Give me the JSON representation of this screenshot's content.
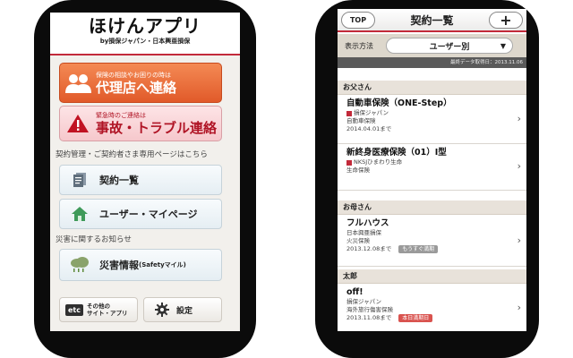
{
  "left": {
    "logo_title": "ほけんアプリ",
    "logo_sub": "by損保ジャパン・日本興亜損保",
    "agent_button": {
      "small": "保険の相談やお困りの時は",
      "big": "代理店へ連絡"
    },
    "emergency_button": {
      "small": "緊急時のご連絡は",
      "big": "事故・トラブル連絡"
    },
    "contract_section": "契約管理・ご契約者さま専用ページはこちら",
    "contract_list": "契約一覧",
    "mypage": "ユーザー・マイページ",
    "disaster_section": "災害に関するお知らせ",
    "disaster_info": "災害情報",
    "safety": "(Safetyマイル)",
    "etc": "etc",
    "other_sites_line1": "その他の",
    "other_sites_line2": "サイト・アプリ",
    "settings": "設定"
  },
  "right": {
    "top_button": "TOP",
    "title": "契約一覧",
    "plus": "+",
    "display_label": "表示方法",
    "display_value": "ユーザー別",
    "update_date": "最終データ取得日：2013.11.06",
    "groups": [
      {
        "name": "お父さん",
        "items": [
          {
            "title": "自動車保険（ONE-Step）",
            "company": "損保ジャパン",
            "type": "自動車保険",
            "date": "2014.04.01まで",
            "badge": ""
          },
          {
            "title": "新終身医療保険（01）Ⅰ型",
            "company": "NKSJひまわり生命",
            "type": "生命保険",
            "date": "",
            "badge": ""
          }
        ]
      },
      {
        "name": "お母さん",
        "items": [
          {
            "title": "フルハウス",
            "company": "日本興亜損保",
            "type": "火災保険",
            "date": "2013.12.08まで",
            "badge": "もうすぐ満期"
          }
        ]
      },
      {
        "name": "太郎",
        "items": [
          {
            "title": "off!",
            "company": "損保ジャパン",
            "type": "海外旅行傷害保険",
            "date": "2013.11.08まで",
            "badge": "本日満期日"
          }
        ]
      }
    ]
  },
  "colors": {
    "accent_red": "#c22a3a",
    "agent_orange": "#e15a2a",
    "emergency_pink": "#f6c8cc"
  },
  "icons": [
    "people-icon",
    "warning-icon",
    "document-icon",
    "home-icon",
    "rain-cloud-icon",
    "gear-icon",
    "chevron-right-icon",
    "dropdown-arrow-icon"
  ]
}
